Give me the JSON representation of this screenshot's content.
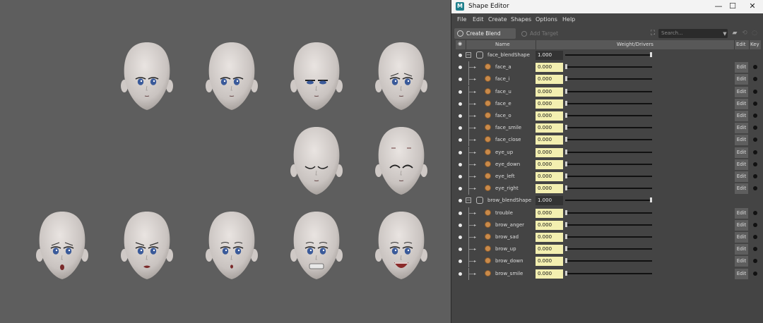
{
  "window": {
    "title": "Shape Editor",
    "minimize_glyph": "—",
    "maximize_glyph": "☐",
    "close_glyph": "✕"
  },
  "menu": [
    "File",
    "Edit",
    "Create",
    "Shapes",
    "Options",
    "Help"
  ],
  "toolbar": {
    "create_label": "Create Blend Shape",
    "add_target_label": "Add Target",
    "search_placeholder": "Search..."
  },
  "columns": {
    "name": "Name",
    "weight": "Weight/Drivers",
    "edit": "Edit",
    "key": "Key"
  },
  "blend_shapes": [
    {
      "name": "face_blendShape",
      "weight": "1.000",
      "targets": [
        {
          "name": "face_a",
          "weight": "0.000",
          "edit": "Edit"
        },
        {
          "name": "face_i",
          "weight": "0.000",
          "edit": "Edit"
        },
        {
          "name": "face_u",
          "weight": "0.000",
          "edit": "Edit"
        },
        {
          "name": "face_e",
          "weight": "0.000",
          "edit": "Edit"
        },
        {
          "name": "face_o",
          "weight": "0.000",
          "edit": "Edit"
        },
        {
          "name": "face_smile",
          "weight": "0.000",
          "edit": "Edit"
        },
        {
          "name": "face_close",
          "weight": "0.000",
          "edit": "Edit"
        },
        {
          "name": "eye_up",
          "weight": "0.000",
          "edit": "Edit"
        },
        {
          "name": "eye_down",
          "weight": "0.000",
          "edit": "Edit"
        },
        {
          "name": "eye_left",
          "weight": "0.000",
          "edit": "Edit"
        },
        {
          "name": "eye_right",
          "weight": "0.000",
          "edit": "Edit"
        }
      ]
    },
    {
      "name": "brow_blendShape",
      "weight": "1.000",
      "targets": [
        {
          "name": "trouble",
          "weight": "0.000",
          "edit": "Edit"
        },
        {
          "name": "brow_anger",
          "weight": "0.000",
          "edit": "Edit"
        },
        {
          "name": "brow_sad",
          "weight": "0.000",
          "edit": "Edit"
        },
        {
          "name": "brow_up",
          "weight": "0.000",
          "edit": "Edit"
        },
        {
          "name": "brow_down",
          "weight": "0.000",
          "edit": "Edit"
        },
        {
          "name": "brow_smile",
          "weight": "0.000",
          "edit": "Edit"
        }
      ]
    }
  ],
  "heads": [
    {
      "expr": "neutral"
    },
    {
      "expr": "look-left"
    },
    {
      "expr": "half-close"
    },
    {
      "expr": "sad-eyes"
    },
    {
      "expr": "closed"
    },
    {
      "expr": "smile-closed"
    },
    {
      "expr": "open-o"
    },
    {
      "expr": "anger"
    },
    {
      "expr": "small-o"
    },
    {
      "expr": "grimace"
    },
    {
      "expr": "open-smile"
    }
  ],
  "colors": {
    "viewport_bg": "#5e5e5e",
    "panel_bg": "#444444",
    "weight_field": "#f3efb0",
    "target_icon": "#c98a4a",
    "eye_blue": "#3a5a9a"
  }
}
